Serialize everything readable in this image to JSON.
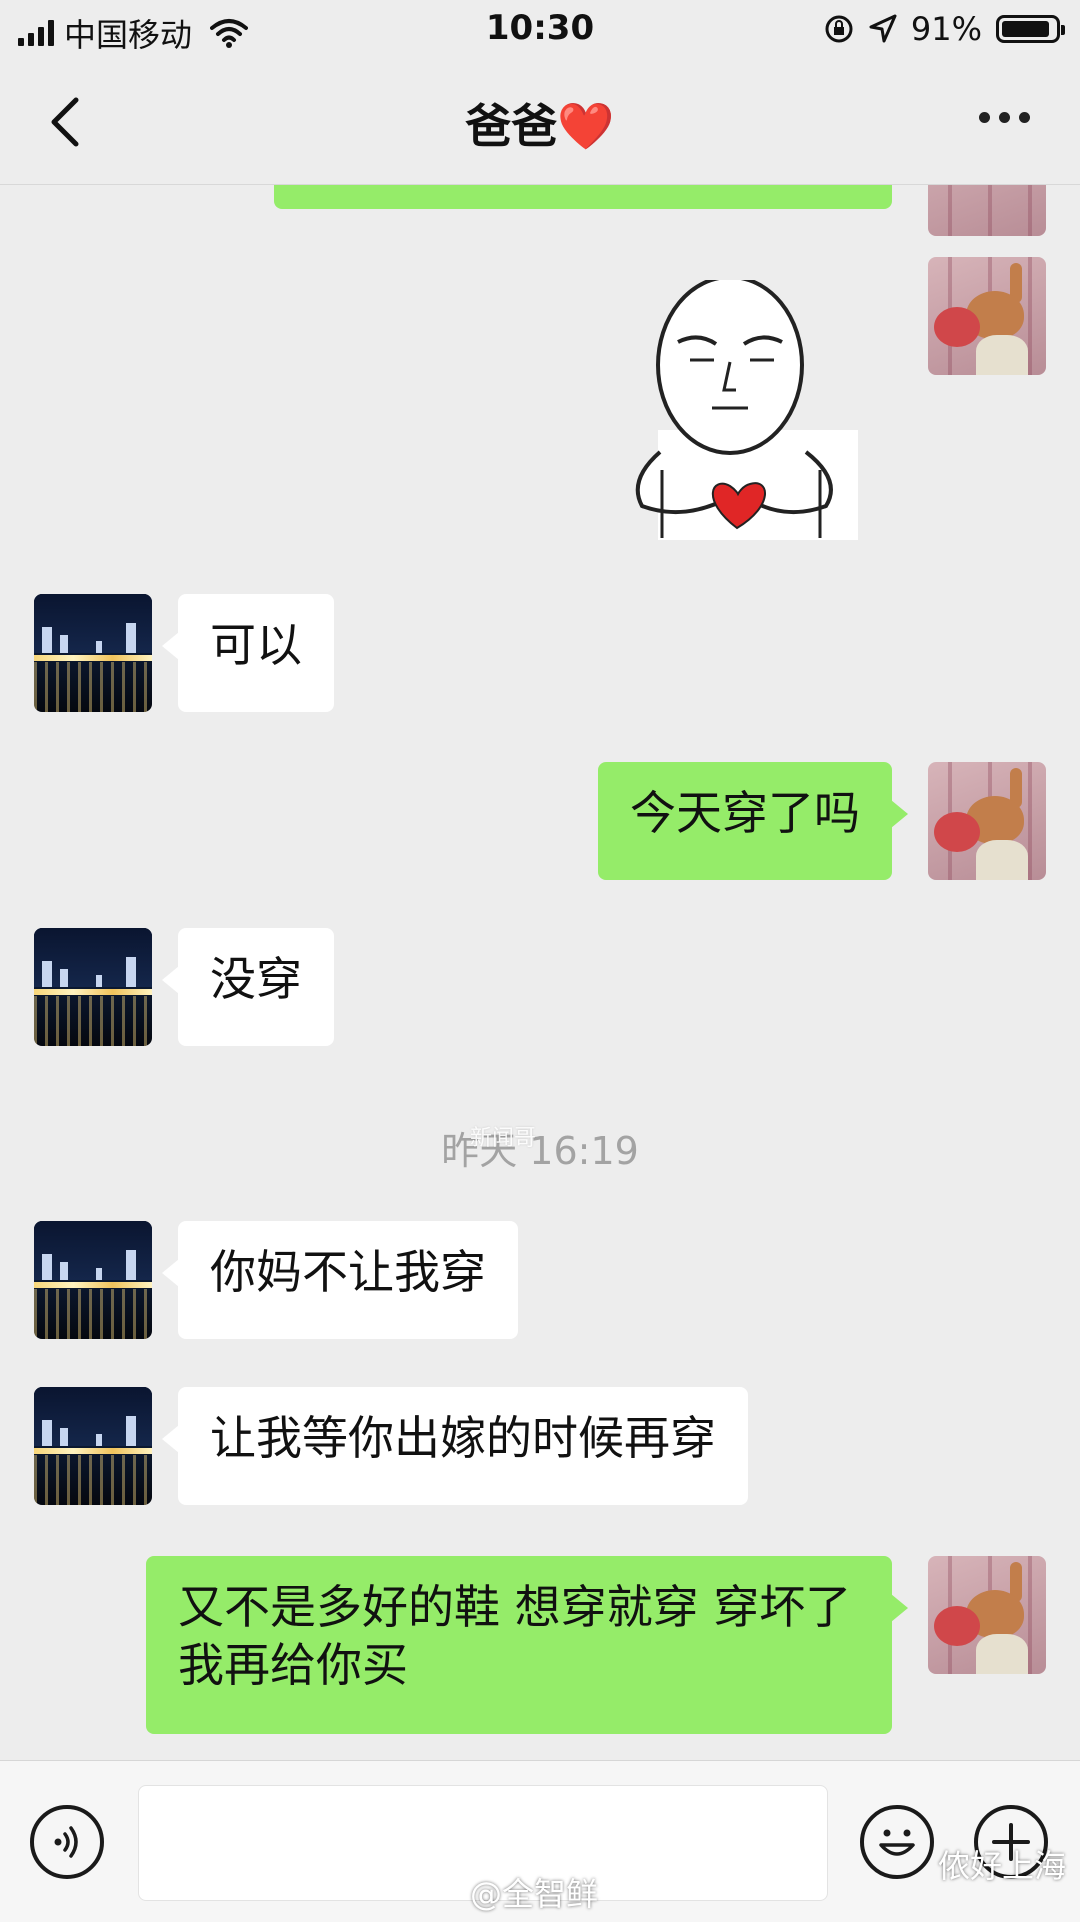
{
  "status_bar": {
    "carrier": "中国移动",
    "time": "10:30",
    "battery": "91%",
    "battery_level": 0.91
  },
  "nav": {
    "title": "爸爸",
    "title_emoji": "❤️",
    "back_icon": "chevron-left-icon",
    "more_icon": "ellipsis-icon"
  },
  "messages": [
    {
      "side": "out",
      "type": "text",
      "text": ""
    },
    {
      "side": "out",
      "type": "sticker",
      "text": ""
    },
    {
      "side": "in",
      "type": "text",
      "text": "可以"
    },
    {
      "side": "out",
      "type": "text",
      "text": "今天穿了吗"
    },
    {
      "side": "in",
      "type": "text",
      "text": "没穿"
    },
    {
      "side": "in",
      "type": "text",
      "text": "你妈不让我穿"
    },
    {
      "side": "in",
      "type": "text",
      "text": "让我等你出嫁的时候再穿"
    },
    {
      "side": "out",
      "type": "text",
      "text": "又不是多好的鞋 想穿就穿 穿坏了我再给你买"
    }
  ],
  "timestamp": "昨天 16:19",
  "input_bar": {
    "value": "",
    "voice_icon": "voice-icon",
    "emoji_icon": "emoji-icon",
    "plus_icon": "plus-icon"
  },
  "watermarks": {
    "weibo": "@全智鲜",
    "wechat": "侬好上海",
    "faint": "新闻哥"
  },
  "colors": {
    "background": "#ededed",
    "outgoing_bubble": "#95ec69",
    "incoming_bubble": "#ffffff",
    "heart": "#e2283a"
  }
}
